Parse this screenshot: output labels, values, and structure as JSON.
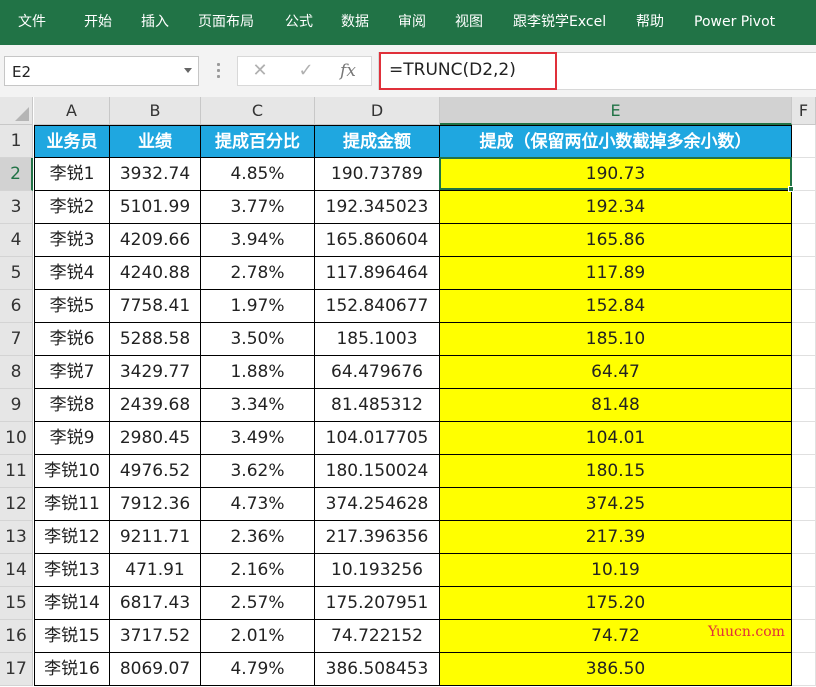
{
  "ribbon": {
    "tabs": [
      "文件",
      "开始",
      "插入",
      "页面布局",
      "公式",
      "数据",
      "审阅",
      "视图",
      "跟李锐学Excel",
      "帮助",
      "Power Pivot"
    ]
  },
  "formula_bar": {
    "name_box": "E2",
    "cancel_icon": "✕",
    "enter_icon": "✓",
    "fx_label": "fx",
    "formula": "=TRUNC(D2,2)"
  },
  "sheet": {
    "columns": [
      "A",
      "B",
      "C",
      "D",
      "E",
      "F"
    ],
    "header_row": [
      "业务员",
      "业绩",
      "提成百分比",
      "提成金额",
      "提成（保留两位小数截掉多余小数）"
    ],
    "rows": [
      [
        "李锐1",
        "3932.74",
        "4.85%",
        "190.73789",
        "190.73"
      ],
      [
        "李锐2",
        "5101.99",
        "3.77%",
        "192.345023",
        "192.34"
      ],
      [
        "李锐3",
        "4209.66",
        "3.94%",
        "165.860604",
        "165.86"
      ],
      [
        "李锐4",
        "4240.88",
        "2.78%",
        "117.896464",
        "117.89"
      ],
      [
        "李锐5",
        "7758.41",
        "1.97%",
        "152.840677",
        "152.84"
      ],
      [
        "李锐6",
        "5288.58",
        "3.50%",
        "185.1003",
        "185.10"
      ],
      [
        "李锐7",
        "3429.77",
        "1.88%",
        "64.479676",
        "64.47"
      ],
      [
        "李锐8",
        "2439.68",
        "3.34%",
        "81.485312",
        "81.48"
      ],
      [
        "李锐9",
        "2980.45",
        "3.49%",
        "104.017705",
        "104.01"
      ],
      [
        "李锐10",
        "4976.52",
        "3.62%",
        "180.150024",
        "180.15"
      ],
      [
        "李锐11",
        "7912.36",
        "4.73%",
        "374.254628",
        "374.25"
      ],
      [
        "李锐12",
        "9211.71",
        "2.36%",
        "217.396356",
        "217.39"
      ],
      [
        "李锐13",
        "471.91",
        "2.16%",
        "10.193256",
        "10.19"
      ],
      [
        "李锐14",
        "6817.43",
        "2.57%",
        "175.207951",
        "175.20"
      ],
      [
        "李锐15",
        "3717.52",
        "2.01%",
        "74.722152",
        "74.72"
      ],
      [
        "李锐16",
        "8069.07",
        "4.79%",
        "386.508453",
        "386.50"
      ]
    ],
    "selected_cell": "E2"
  },
  "watermark": "Yuucn.com",
  "colors": {
    "ribbon": "#217346",
    "header_fill": "#1fa7e0",
    "result_fill": "#ffff00",
    "highlight_box": "#e0303a"
  }
}
